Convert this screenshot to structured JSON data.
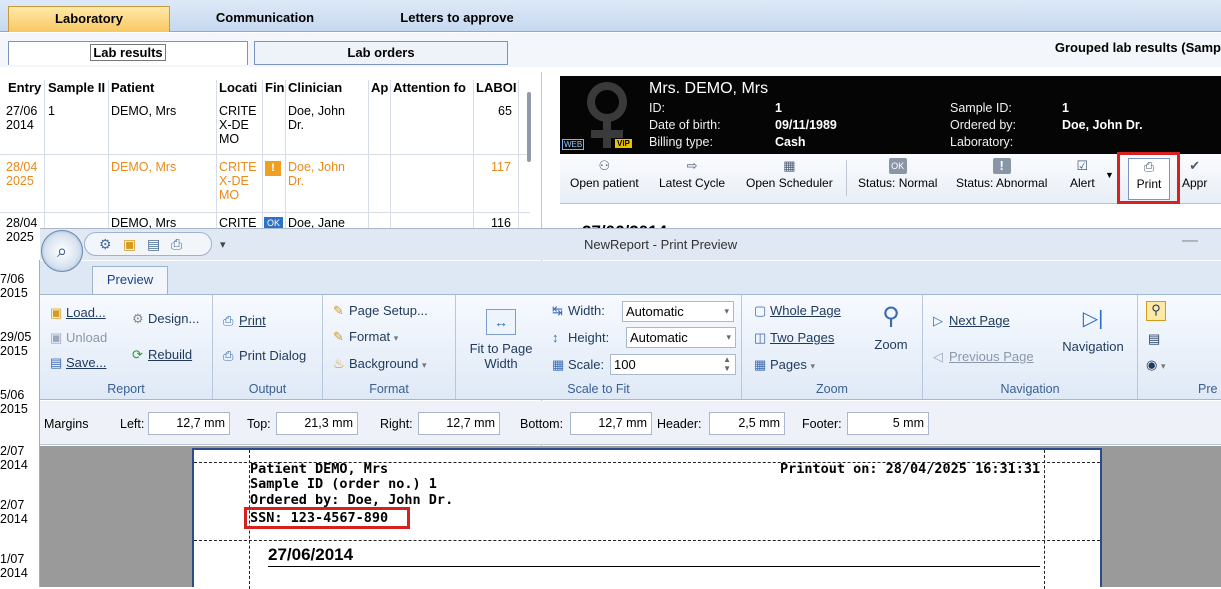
{
  "top_tabs": [
    "Laboratory",
    "Communication",
    "Letters to approve"
  ],
  "sub_tabs": {
    "lab_results": "Lab results",
    "lab_orders": "Lab orders"
  },
  "grouped_title": "Grouped lab results (Samp",
  "grid": {
    "headers": [
      "Entry",
      "Sample II",
      "Patient",
      "Locati",
      "Fin",
      "Clinician",
      "Ap",
      "Attention fo",
      "LABOI"
    ],
    "rows": [
      {
        "entry": "27/06\n2014",
        "sample": "1",
        "patient": "DEMO, Mrs",
        "location": "CRITE\nX-DE\nMO",
        "fin": "",
        "clinician": "Doe, John\nDr.",
        "labo": "65"
      },
      {
        "entry": "28/04\n2025",
        "sample": "",
        "patient": "DEMO, Mrs",
        "location": "CRITE\nX-DE\nMO",
        "fin": "!",
        "clinician": "Doe, John\nDr.",
        "labo": "117"
      },
      {
        "entry": "28/04\n2025",
        "sample": "",
        "patient": "DEMO, Mrs",
        "location": "CRITE",
        "fin": "OK",
        "clinician": "Doe, Jane",
        "labo": "116"
      }
    ],
    "more_dates": [
      "7/06\n2015",
      "29/05\n2015",
      "5/06\n2015",
      "2/07\n2014",
      "2/07\n2014",
      "1/07\n2014"
    ]
  },
  "banner": {
    "name": "Mrs. DEMO, Mrs",
    "labels": {
      "id": "ID:",
      "dob": "Date of birth:",
      "billing": "Billing type:",
      "sample_id": "Sample ID:",
      "ordered_by": "Ordered by:",
      "laboratory": "Laboratory:"
    },
    "values": {
      "id": "1",
      "dob": "09/11/1989",
      "billing": "Cash",
      "sample_id": "1",
      "ordered_by": "Doe, John Dr.",
      "laboratory": ""
    },
    "web": "WEB",
    "vip": "VIP"
  },
  "actions": [
    "Open patient",
    "Latest Cycle",
    "Open Scheduler",
    "Status: Normal",
    "Status: Abnormal",
    "Alert",
    "Print",
    "Appr"
  ],
  "behind_date": "27/06/2014",
  "print_preview": {
    "title": "NewReport - Print Preview",
    "tab": "Preview",
    "groups": {
      "report": {
        "label": "Report",
        "load": "Load...",
        "unload": "Unload",
        "save": "Save...",
        "design": "Design...",
        "rebuild": "Rebuild"
      },
      "output": {
        "label": "Output",
        "print": "Print",
        "print_dialog": "Print Dialog"
      },
      "format": {
        "label": "Format",
        "page_setup": "Page Setup...",
        "format": "Format",
        "background": "Background"
      },
      "scale": {
        "label": "Scale to Fit",
        "fit": "Fit to Page\nWidth",
        "width_label": "Width:",
        "width_value": "Automatic",
        "height_label": "Height:",
        "height_value": "Automatic",
        "scale_label": "Scale:",
        "scale_value": "100"
      },
      "zoom": {
        "label": "Zoom",
        "whole": "Whole Page",
        "two": "Two Pages",
        "pages": "Pages",
        "zoom": "Zoom"
      },
      "nav": {
        "label": "Navigation",
        "next": "Next Page",
        "prev": "Previous Page",
        "navigation": "Navigation"
      },
      "pre": {
        "label": "Pre"
      }
    },
    "margins": {
      "label": "Margins",
      "left_label": "Left:",
      "left": "12,7 mm",
      "top_label": "Top:",
      "top": "21,3 mm",
      "right_label": "Right:",
      "right": "12,7 mm",
      "bottom_label": "Bottom:",
      "bottom": "12,7 mm",
      "header_label": "Header:",
      "header": "2,5 mm",
      "footer_label": "Footer:",
      "footer": "5 mm"
    },
    "paper": {
      "patient": "Patient DEMO, Mrs",
      "sample": "Sample ID (order no.) 1",
      "ordered": "Ordered by: Doe, John Dr.",
      "ssn": "SSN: 123-4567-890",
      "printout": "Printout on: 28/04/2025  16:31:31",
      "date": "27/06/2014"
    }
  },
  "colors": {
    "highlight": "#d72020",
    "orange": "#e98a1a",
    "banner": "#050505"
  }
}
